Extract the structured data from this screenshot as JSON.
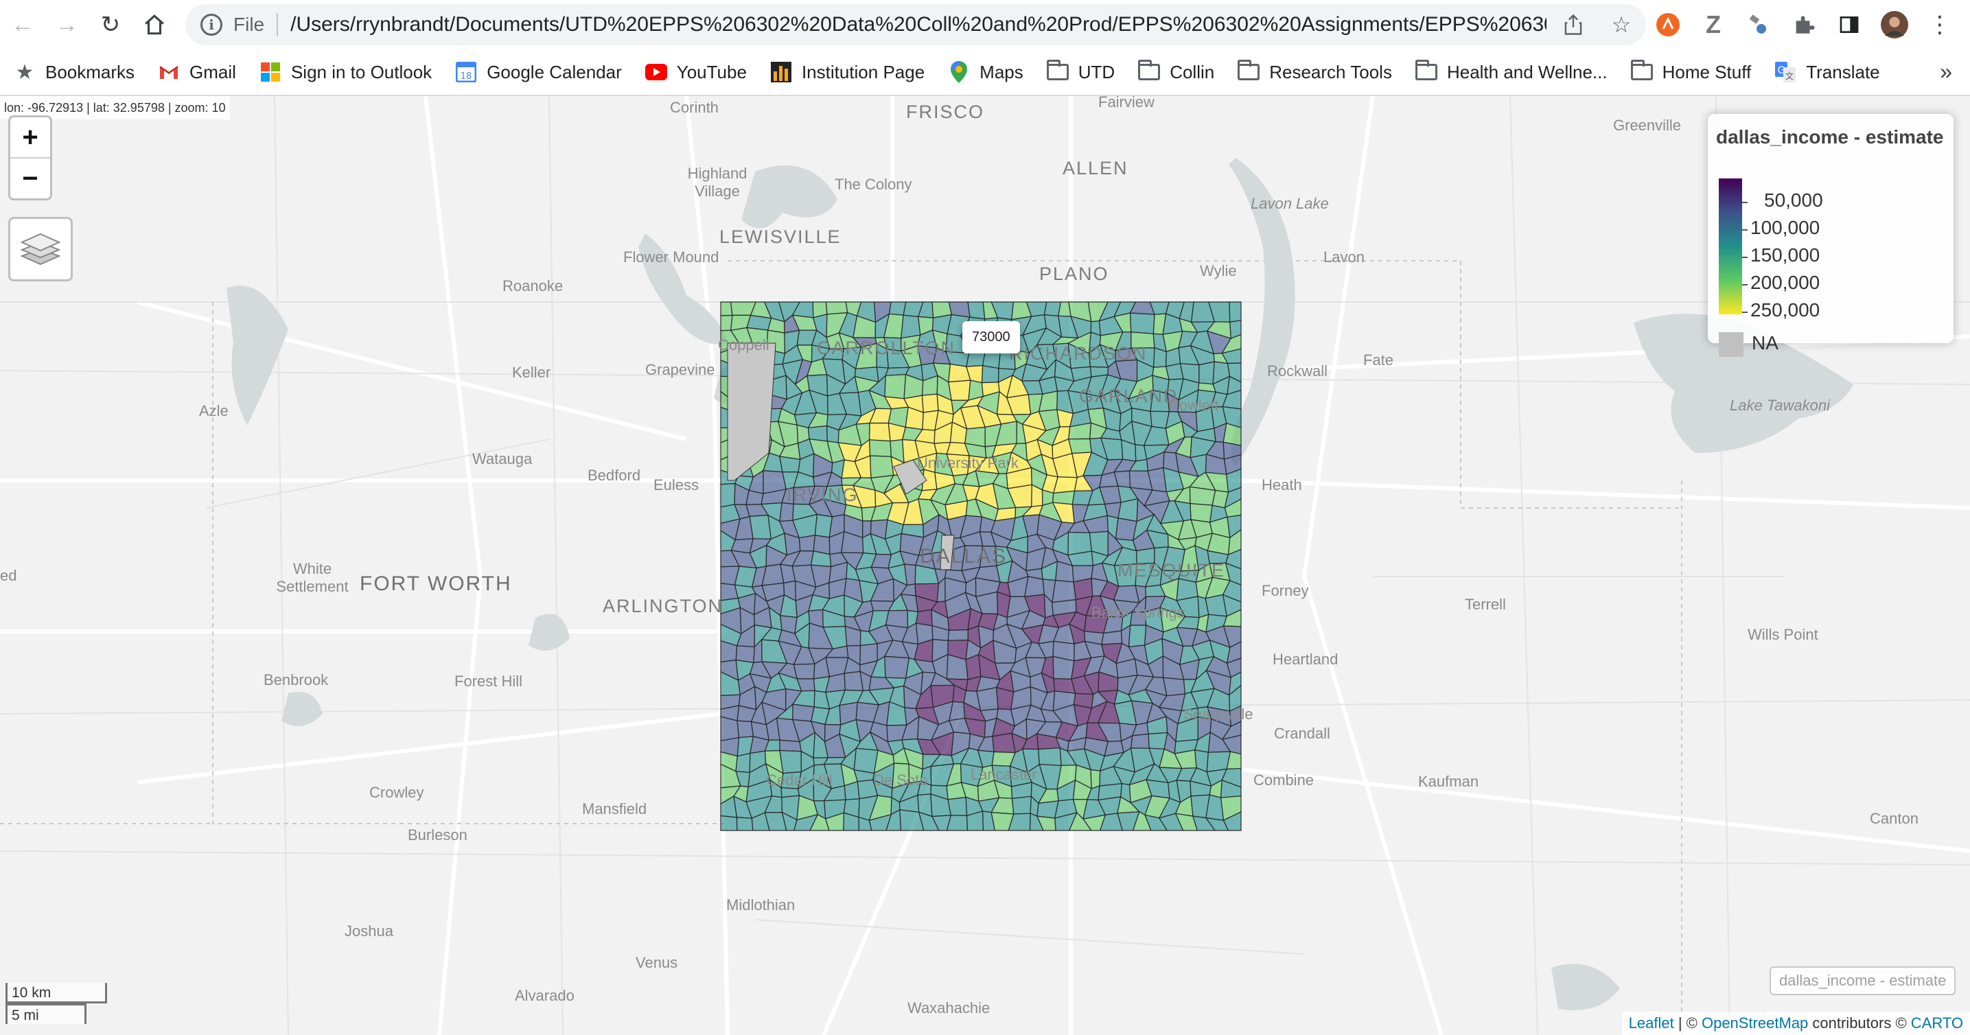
{
  "browser": {
    "scheme": "File",
    "url": "/Users/rrynbrandt/Documents/UTD%20EPPS%206302%20Data%20Coll%20and%20Prod/EPPS%206302%20Assignments/EPPS%20630...",
    "icons": [
      "back-icon",
      "forward-icon",
      "reload-icon",
      "home-icon",
      "share-icon",
      "star-icon"
    ]
  },
  "bookmarks": [
    {
      "label": "Bookmarks",
      "icon": "star-icon"
    },
    {
      "label": "Gmail",
      "icon": "gmail-icon"
    },
    {
      "label": "Sign in to Outlook",
      "icon": "microsoft-icon"
    },
    {
      "label": "Google Calendar",
      "icon": "calendar-icon"
    },
    {
      "label": "YouTube",
      "icon": "youtube-icon"
    },
    {
      "label": "Institution Page",
      "icon": "chart-icon"
    },
    {
      "label": "Maps",
      "icon": "maps-pin-icon"
    },
    {
      "label": "UTD",
      "icon": "folder-icon"
    },
    {
      "label": "Collin",
      "icon": "folder-icon"
    },
    {
      "label": "Research Tools",
      "icon": "folder-icon"
    },
    {
      "label": "Health and Wellne...",
      "icon": "folder-icon"
    },
    {
      "label": "Home Stuff",
      "icon": "folder-icon"
    },
    {
      "label": "Translate",
      "icon": "translate-icon"
    }
  ],
  "bookmarks_more": "»",
  "map": {
    "coords": "lon: -96.72913 | lat: 32.95798 | zoom: 10",
    "zoom_in": "+",
    "zoom_out": "−",
    "tooltip": "73000",
    "legend": {
      "title": "dallas_income - estimate",
      "labels": [
        "50,000",
        "100,000",
        "150,000",
        "200,000",
        "250,000"
      ],
      "na_label": "NA",
      "colors": [
        "#440154",
        "#3b528b",
        "#21908c",
        "#5dc963",
        "#fde725"
      ]
    },
    "layer_label": "dallas_income - estimate",
    "attribution": {
      "leaflet": "Leaflet",
      "sep": " | © ",
      "osm": "OpenStreetMap",
      "contrib": " contributors © ",
      "carto": "CARTO"
    },
    "scale": {
      "km": "10 km",
      "mi": "5 mi"
    },
    "places": {
      "corinth": "Corinth",
      "frisco": "FRISCO",
      "fairview": "Fairview",
      "greenville": "Greenville",
      "highland": "Highland Village",
      "colony": "The Colony",
      "allen": "ALLEN",
      "lavon_lake": "Lavon Lake",
      "lewisville": "LEWISVILLE",
      "flower": "Flower Mound",
      "plano": "PLANO",
      "wylie": "Wylie",
      "lavon": "Lavon",
      "roanoke": "Roanoke",
      "carrollton": "CARROLLTON",
      "richardson": "RICHARDSON",
      "garland": "GARLAND",
      "rowlett": "Rowlett",
      "coppell": "Coppell",
      "keller": "Keller",
      "grapevine": "Grapevine",
      "rockwall": "Rockwall",
      "fate": "Fate",
      "azle": "Azle",
      "lake_tawakoni": "Lake Tawakoni",
      "watauga": "Watauga",
      "bedford": "Bedford",
      "euless": "Euless",
      "irving": "IRVING",
      "university_park": "University Park",
      "heath": "Heath",
      "dallas": "DALLAS",
      "mesquite": "MESQUITE",
      "white_settlement": "White Settlement",
      "fort_worth": "FORT WORTH",
      "arlington": "ARLINGTON",
      "forney": "Forney",
      "balch": "Balch Springs",
      "terrell": "Terrell",
      "wills_point": "Wills Point",
      "benbrook": "Benbrook",
      "forest_hill": "Forest Hill",
      "heartland": "Heartland",
      "seagoville": "Seagoville",
      "crandall": "Crandall",
      "crowley": "Crowley",
      "cedar_hill": "Cedar Hill",
      "desoto": "De Soto",
      "lancaster": "Lancaster",
      "combine": "Combine",
      "kaufman": "Kaufman",
      "mansfield": "Mansfield",
      "burleson": "Burleson",
      "canton": "Canton",
      "midlothian": "Midlothian",
      "joshua": "Joshua",
      "venus": "Venus",
      "alvarado": "Alvarado",
      "waxahachie": "Waxahachie",
      "ed": "ed"
    }
  }
}
